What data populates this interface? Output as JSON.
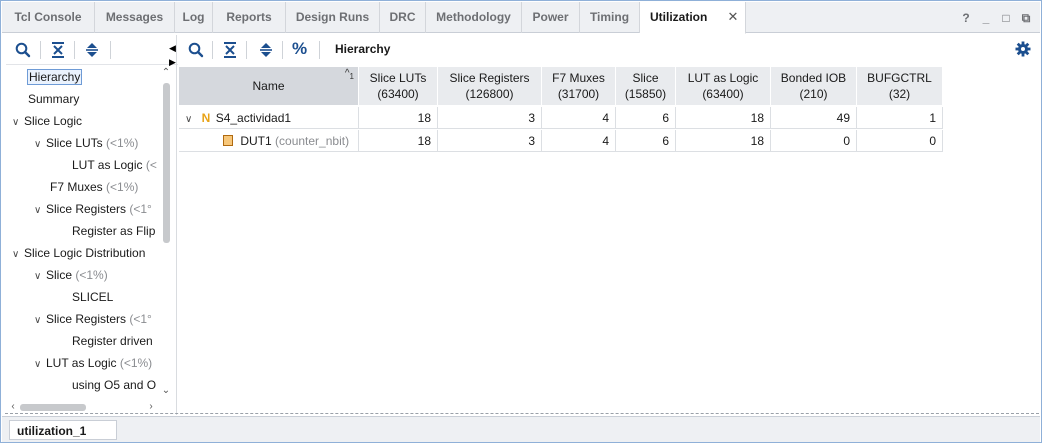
{
  "tabs": [
    {
      "label": "Tcl Console"
    },
    {
      "label": "Messages"
    },
    {
      "label": "Log"
    },
    {
      "label": "Reports"
    },
    {
      "label": "Design Runs"
    },
    {
      "label": "DRC"
    },
    {
      "label": "Methodology"
    },
    {
      "label": "Power"
    },
    {
      "label": "Timing"
    },
    {
      "label": "Utilization"
    }
  ],
  "active_tab": "Utilization",
  "window_buttons": {
    "help": "?",
    "minimize": "_",
    "restore": "□",
    "float": "⧉"
  },
  "left_tree": [
    {
      "label": "Hierarchy",
      "pct": "",
      "caret": ""
    },
    {
      "label": "Summary",
      "pct": "",
      "caret": ""
    },
    {
      "label": "Slice Logic",
      "pct": "",
      "caret": "⌄"
    },
    {
      "label": "Slice LUTs",
      "pct": "(<1%)",
      "caret": "⌄"
    },
    {
      "label": "LUT as Logic",
      "pct": "(<",
      "caret": ""
    },
    {
      "label": "F7 Muxes",
      "pct": "(<1%)",
      "caret": ""
    },
    {
      "label": "Slice Registers",
      "pct": "(<1°",
      "caret": "⌄"
    },
    {
      "label": "Register as Flip",
      "pct": "",
      "caret": ""
    },
    {
      "label": "Slice Logic Distribution",
      "pct": "",
      "caret": "⌄"
    },
    {
      "label": "Slice",
      "pct": "(<1%)",
      "caret": "⌄"
    },
    {
      "label": "SLICEL",
      "pct": "",
      "caret": ""
    },
    {
      "label": "Slice Registers",
      "pct": "(<1°",
      "caret": "⌄"
    },
    {
      "label": "Register driven",
      "pct": "",
      "caret": ""
    },
    {
      "label": "LUT as Logic",
      "pct": "(<1%)",
      "caret": "⌄"
    },
    {
      "label": "using O5 and O",
      "pct": "",
      "caret": ""
    }
  ],
  "right_toolbar": {
    "percent_symbol": "%",
    "title": "Hierarchy"
  },
  "table": {
    "headers": [
      {
        "line1": "Name",
        "line2": ""
      },
      {
        "line1": "Slice LUTs",
        "line2": "(63400)"
      },
      {
        "line1": "Slice Registers",
        "line2": "(126800)"
      },
      {
        "line1": "F7 Muxes",
        "line2": "(31700)"
      },
      {
        "line1": "Slice",
        "line2": "(15850)"
      },
      {
        "line1": "LUT as Logic",
        "line2": "(63400)"
      },
      {
        "line1": "Bonded IOB",
        "line2": "(210)"
      },
      {
        "line1": "BUFGCTRL",
        "line2": "(32)"
      }
    ],
    "sort_indicator": "^",
    "sort_order": "1",
    "rows": [
      {
        "name": "S4_actividad1",
        "module": "",
        "values": [
          "18",
          "3",
          "4",
          "6",
          "18",
          "49",
          "1"
        ]
      },
      {
        "name": "DUT1",
        "module": "(counter_nbit)",
        "values": [
          "18",
          "3",
          "4",
          "6",
          "18",
          "0",
          "0"
        ]
      }
    ]
  },
  "bottom_tab": "utilization_1",
  "colors": {
    "accent": "#1c6fd1",
    "top_icon": "#e8a317"
  }
}
